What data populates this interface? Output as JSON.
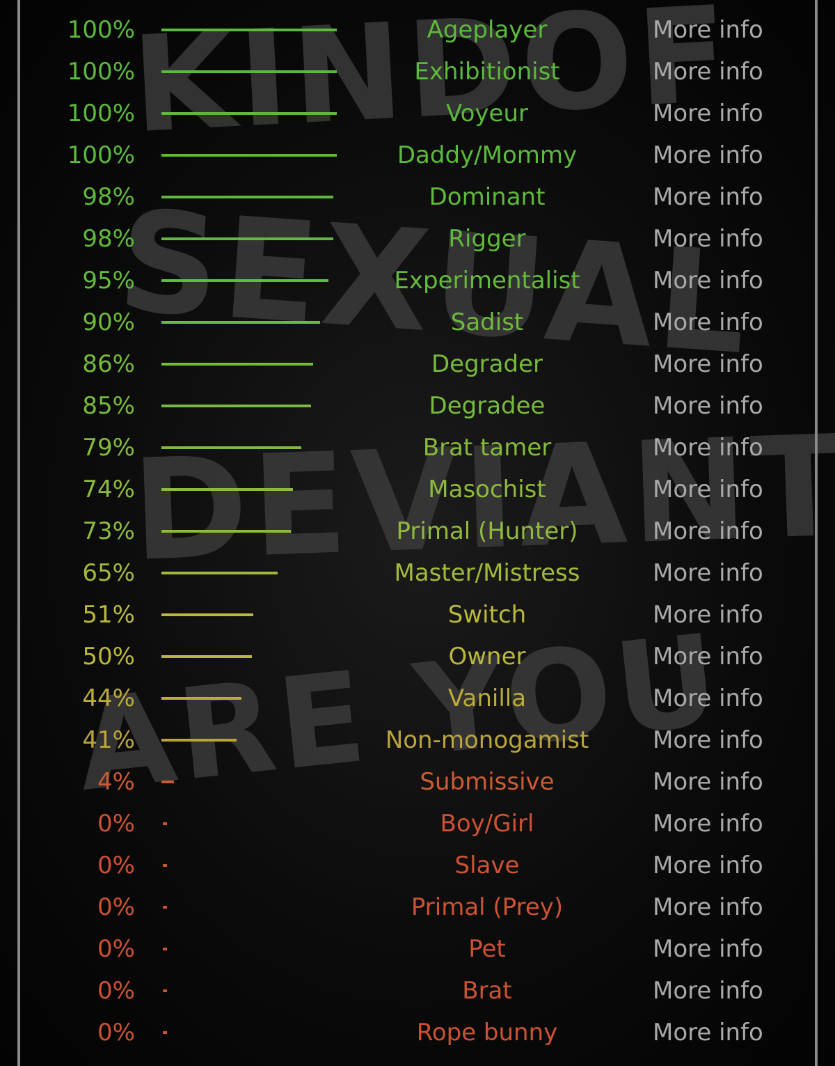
{
  "background_text": [
    "KINDOF",
    "SEXUAL",
    "DEVIANT",
    "ARE YOU"
  ],
  "colors": {
    "high": "#5cb83f",
    "mid": "#c9b240",
    "low": "#cc4433",
    "more_info": "#a9a9a9",
    "frame": "#8a8a8a"
  },
  "more_info_label": "More info",
  "results": [
    {
      "percent": "100%",
      "value": 100,
      "name": "Ageplayer"
    },
    {
      "percent": "100%",
      "value": 100,
      "name": "Exhibitionist"
    },
    {
      "percent": "100%",
      "value": 100,
      "name": "Voyeur"
    },
    {
      "percent": "100%",
      "value": 100,
      "name": "Daddy/Mommy"
    },
    {
      "percent": "98%",
      "value": 98,
      "name": "Dominant"
    },
    {
      "percent": "98%",
      "value": 98,
      "name": "Rigger"
    },
    {
      "percent": "95%",
      "value": 95,
      "name": "Experimentalist"
    },
    {
      "percent": "90%",
      "value": 90,
      "name": "Sadist"
    },
    {
      "percent": "86%",
      "value": 86,
      "name": "Degrader"
    },
    {
      "percent": "85%",
      "value": 85,
      "name": "Degradee"
    },
    {
      "percent": "79%",
      "value": 79,
      "name": "Brat tamer"
    },
    {
      "percent": "74%",
      "value": 74,
      "name": "Masochist"
    },
    {
      "percent": "73%",
      "value": 73,
      "name": "Primal (Hunter)"
    },
    {
      "percent": "65%",
      "value": 65,
      "name": "Master/Mistress"
    },
    {
      "percent": "51%",
      "value": 51,
      "name": "Switch"
    },
    {
      "percent": "50%",
      "value": 50,
      "name": "Owner"
    },
    {
      "percent": "44%",
      "value": 44,
      "name": "Vanilla"
    },
    {
      "percent": "41%",
      "value": 41,
      "name": "Non-monogamist"
    },
    {
      "percent": "4%",
      "value": 4,
      "name": "Submissive"
    },
    {
      "percent": "0%",
      "value": 0,
      "name": "Boy/Girl"
    },
    {
      "percent": "0%",
      "value": 0,
      "name": "Slave"
    },
    {
      "percent": "0%",
      "value": 0,
      "name": "Primal (Prey)"
    },
    {
      "percent": "0%",
      "value": 0,
      "name": "Pet"
    },
    {
      "percent": "0%",
      "value": 0,
      "name": "Brat"
    },
    {
      "percent": "0%",
      "value": 0,
      "name": "Rope bunny"
    }
  ]
}
